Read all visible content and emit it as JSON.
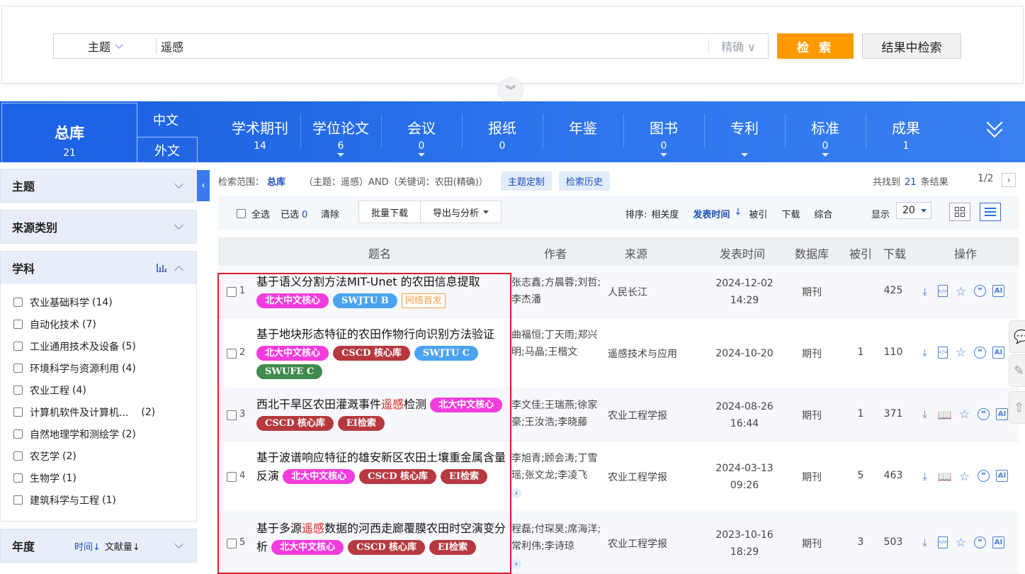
{
  "search": {
    "field": "主题",
    "query": "遥感",
    "match": "精确 ∨",
    "search_btn": "检 索",
    "in_results_btn": "结果中检索",
    "expand": "︾"
  },
  "nav": {
    "total_label": "总库",
    "total_count": "21",
    "lang_cn": "中文",
    "lang_en": "外文",
    "items": [
      {
        "label": "学术期刊",
        "count": "14",
        "dropdown": false
      },
      {
        "label": "学位论文",
        "count": "6",
        "dropdown": true
      },
      {
        "label": "会议",
        "count": "0",
        "dropdown": true
      },
      {
        "label": "报纸",
        "count": "0",
        "dropdown": false
      },
      {
        "label": "年鉴",
        "count": "",
        "dropdown": false
      },
      {
        "label": "图书",
        "count": "0",
        "dropdown": true
      },
      {
        "label": "专利",
        "count": "",
        "dropdown": true
      },
      {
        "label": "标准",
        "count": "0",
        "dropdown": true
      },
      {
        "label": "成果",
        "count": "1",
        "dropdown": false
      }
    ]
  },
  "left": {
    "groups": [
      "主题",
      "来源类别"
    ],
    "subject_title": "学科",
    "subjects": [
      {
        "name": "农业基础科学",
        "count": "(14)"
      },
      {
        "name": "自动化技术",
        "count": "(7)"
      },
      {
        "name": "工业通用技术及设备",
        "count": "(5)"
      },
      {
        "name": "环境科学与资源利用",
        "count": "(4)"
      },
      {
        "name": "农业工程",
        "count": "(4)"
      },
      {
        "name": "计算机软件及计算机...",
        "count": "(2)"
      },
      {
        "name": "自然地理学和测绘学",
        "count": "(2)"
      },
      {
        "name": "农艺学",
        "count": "(2)"
      },
      {
        "name": "生物学",
        "count": "(1)"
      },
      {
        "name": "建筑科学与工程",
        "count": "(1)"
      }
    ],
    "year_title": "年度",
    "year_sort_time": "时间↓",
    "year_sort_count": "文献量↓"
  },
  "scope": {
    "label": "检索范围：",
    "value": "总库",
    "expr": "（主题：遥感）AND（关键词：农田(精确)）",
    "custom": "主题定制",
    "history": "检索历史",
    "found_pre": "共找到",
    "found_num": "21",
    "found_post": "条结果",
    "page": "1/2",
    "next": "›"
  },
  "toolbar": {
    "select_all": "全选",
    "selected_label": "已选",
    "selected_count": "0",
    "clear": "清除",
    "batch_download": "批量下载",
    "export": "导出与分析",
    "sort_label": "排序:",
    "sort_relevance": "相关度",
    "sort_date": "发表时间",
    "sort_date_arrow": "↓",
    "sort_cited": "被引",
    "sort_download": "下载",
    "sort_overall": "综合",
    "show_label": "显示",
    "show_value": "20"
  },
  "table": {
    "headers": {
      "title": "题名",
      "author": "作者",
      "source": "来源",
      "date": "发表时间",
      "db": "数据库",
      "cited": "被引",
      "download": "下载",
      "ops": "操作"
    },
    "rows": [
      {
        "num": "1",
        "title_parts": [
          [
            "基于语义分割方法MIT-Unet 的农田信息提取",
            false
          ]
        ],
        "tags": [
          [
            "北大中文核心",
            "pku"
          ],
          [
            "SWJTU B",
            "sw"
          ],
          [
            "网络首发",
            "first"
          ]
        ],
        "authors": "张志鑫;方晨蓉;刘哲;李杰潘",
        "more": false,
        "source": "人民长江",
        "date1": "2024-12-02",
        "date2": "14:29",
        "db": "期刊",
        "cited": "",
        "download": "425",
        "doc": "html"
      },
      {
        "num": "2",
        "title_parts": [
          [
            "基于地块形态特征的农田作物行向识别方法验证",
            false
          ]
        ],
        "tags": [
          [
            "北大中文核心",
            "pku"
          ],
          [
            "CSCD 核心库",
            "cscd"
          ],
          [
            "SWJTU C",
            "sw"
          ],
          [
            "SWUFE C",
            "swufe"
          ]
        ],
        "authors": "曲福恒;丁天雨;郑兴明;马晶;王楷文",
        "more": false,
        "source": "遥感技术与应用",
        "date1": "2024-10-20",
        "date2": "",
        "db": "期刊",
        "cited": "1",
        "download": "110",
        "doc": "html"
      },
      {
        "num": "3",
        "title_parts": [
          [
            "西北干旱区农田灌溉事件",
            false
          ],
          [
            "遥感",
            true
          ],
          [
            "检测",
            false
          ]
        ],
        "tags": [
          [
            "北大中文核心",
            "pku"
          ],
          [
            "CSCD 核心库",
            "cscd"
          ],
          [
            "EI检索",
            "ei"
          ]
        ],
        "authors": "李文佳;王瑞燕;徐家豪;王汝浩;李晓藤",
        "more": false,
        "source": "农业工程学报",
        "date1": "2024-08-26",
        "date2": "16:44",
        "db": "期刊",
        "cited": "1",
        "download": "371",
        "doc": "book"
      },
      {
        "num": "4",
        "title_parts": [
          [
            "基于波谱响应特征的雄安新区农田土壤重金属含量反演",
            false
          ]
        ],
        "tags": [
          [
            "北大中文核心",
            "pku"
          ],
          [
            "CSCD 核心库",
            "cscd"
          ],
          [
            "EI检索",
            "ei"
          ]
        ],
        "authors": "李旭青;顾会涛;丁雪瑶;张文龙;李凌飞",
        "more": true,
        "source": "农业工程学报",
        "date1": "2024-03-13",
        "date2": "09:26",
        "db": "期刊",
        "cited": "5",
        "download": "463",
        "doc": "book"
      },
      {
        "num": "5",
        "title_parts": [
          [
            "基于多源",
            false
          ],
          [
            "遥感",
            true
          ],
          [
            "数据的河西走廊覆膜农田时空演变分析",
            false
          ]
        ],
        "tags": [
          [
            "北大中文核心",
            "pku"
          ],
          [
            "CSCD 核心库",
            "cscd"
          ],
          [
            "EI检索",
            "ei"
          ]
        ],
        "authors": "程磊;付琛昊;席海洋;常利伟;李诗琼",
        "more": true,
        "source": "农业工程学报",
        "date1": "2023-10-16",
        "date2": "18:29",
        "db": "期刊",
        "cited": "3",
        "download": "503",
        "doc": "html"
      }
    ]
  },
  "colors": {
    "accent": "#1a5fe0",
    "search_btn": "#ff9a00",
    "highlight": "#e02020",
    "redbox": "#d91f2b"
  }
}
